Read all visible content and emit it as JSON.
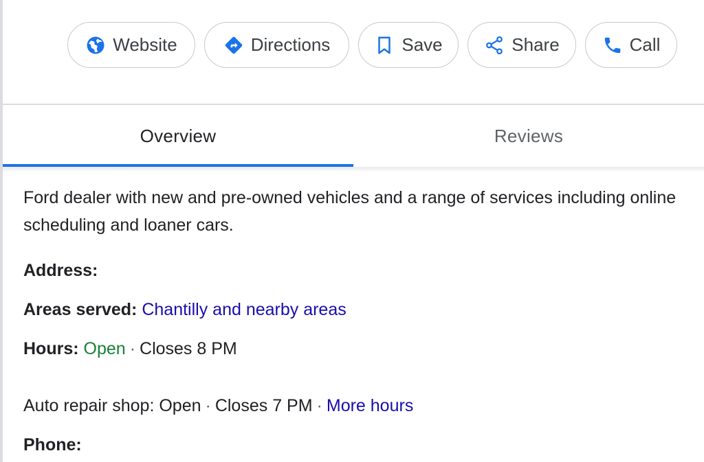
{
  "actions": [
    {
      "label": "Website",
      "icon": "globe-icon"
    },
    {
      "label": "Directions",
      "icon": "directions-icon"
    },
    {
      "label": "Save",
      "icon": "bookmark-icon"
    },
    {
      "label": "Share",
      "icon": "share-icon"
    },
    {
      "label": "Call",
      "icon": "phone-icon"
    }
  ],
  "tabs": {
    "overview": "Overview",
    "reviews": "Reviews",
    "active": "Overview"
  },
  "colors": {
    "accent": "#1a73e8",
    "link": "#1a0dab",
    "open": "#188038"
  },
  "overview": {
    "description": "Ford dealer with new and pre-owned vehicles and a range of services including online scheduling and loaner cars.",
    "address_label": "Address:",
    "areas_label": "Areas served:",
    "areas_value": "Chantilly and nearby areas",
    "hours_label": "Hours:",
    "hours_status": "Open",
    "hours_separator": "·",
    "hours_closes": "Closes 8 PM",
    "auto_repair_text": "Auto repair shop: Open",
    "auto_repair_separator": "·",
    "auto_repair_closes": "Closes 7 PM",
    "more_hours_separator": "·",
    "more_hours": "More hours",
    "phone_label": "Phone:"
  }
}
